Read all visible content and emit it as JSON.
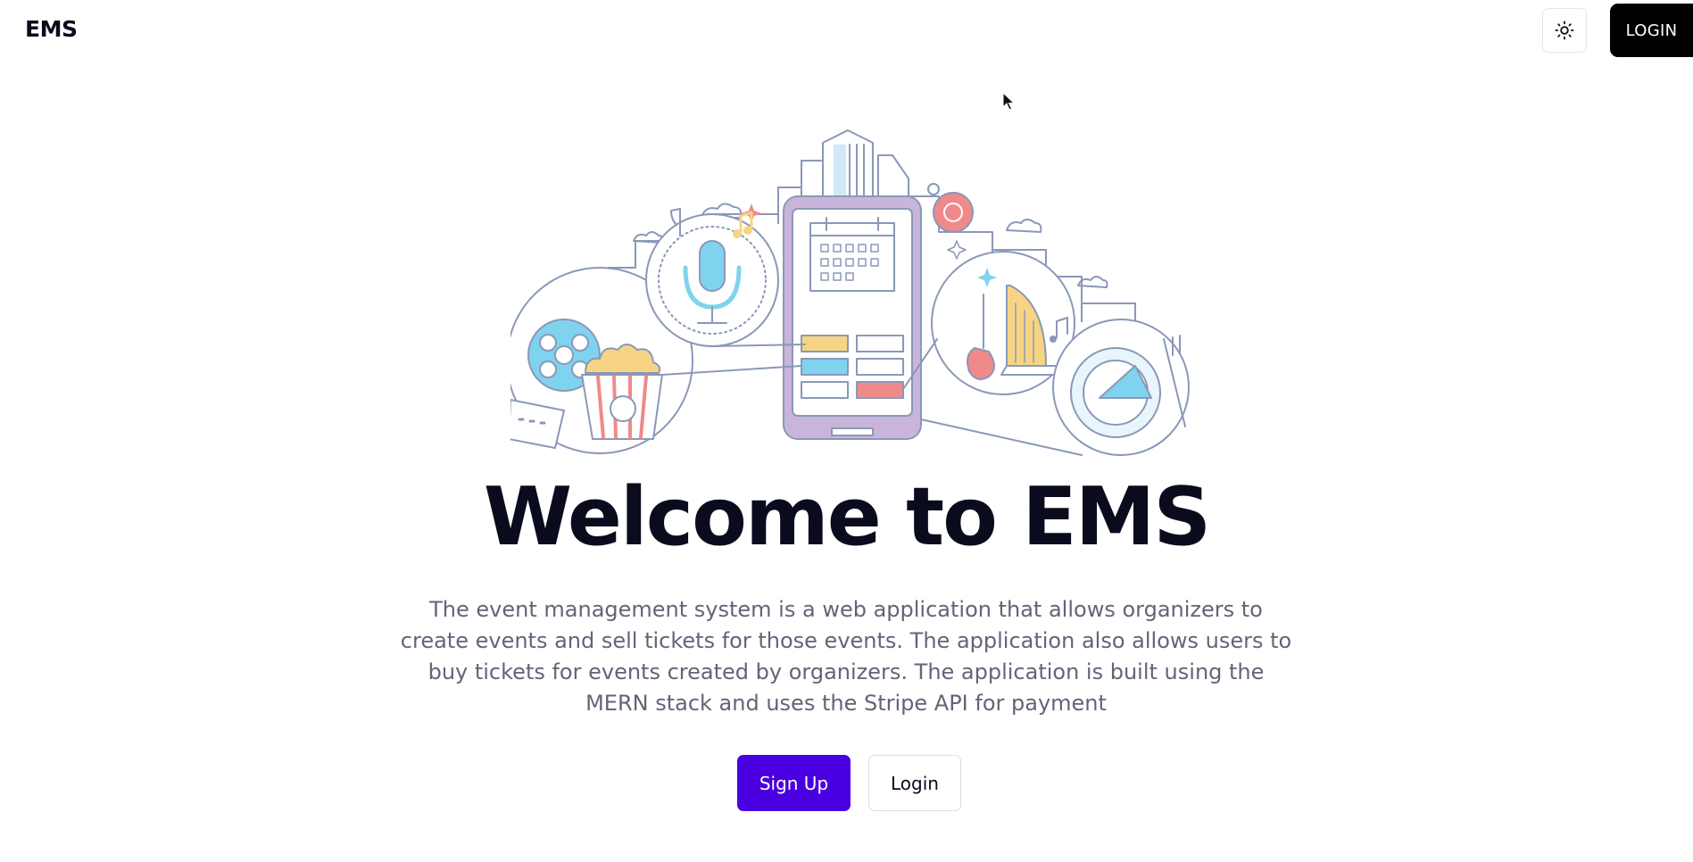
{
  "navbar": {
    "brand": "EMS",
    "theme_toggle_icon": "sun-icon",
    "login_label": "LOGIN"
  },
  "hero": {
    "illustration": "event-city-illustration",
    "title": "Welcome to EMS",
    "description": "The event management system is a web application that allows organizers to create events and sell tickets for those events. The application also allows users to buy tickets for events created by organizers. The application is built using the MERN stack and uses the Stripe API for payment",
    "signup_label": "Sign Up",
    "login_label": "Login"
  },
  "colors": {
    "primary": "#4a00e0",
    "dark": "#0b0b1e",
    "muted_text": "#636477",
    "illustration_line": "#8a98b8",
    "illustration_blue": "#7fd3ee",
    "illustration_yellow": "#f7d483",
    "illustration_red": "#f08a8a",
    "illustration_purple": "#c9b5d9"
  }
}
